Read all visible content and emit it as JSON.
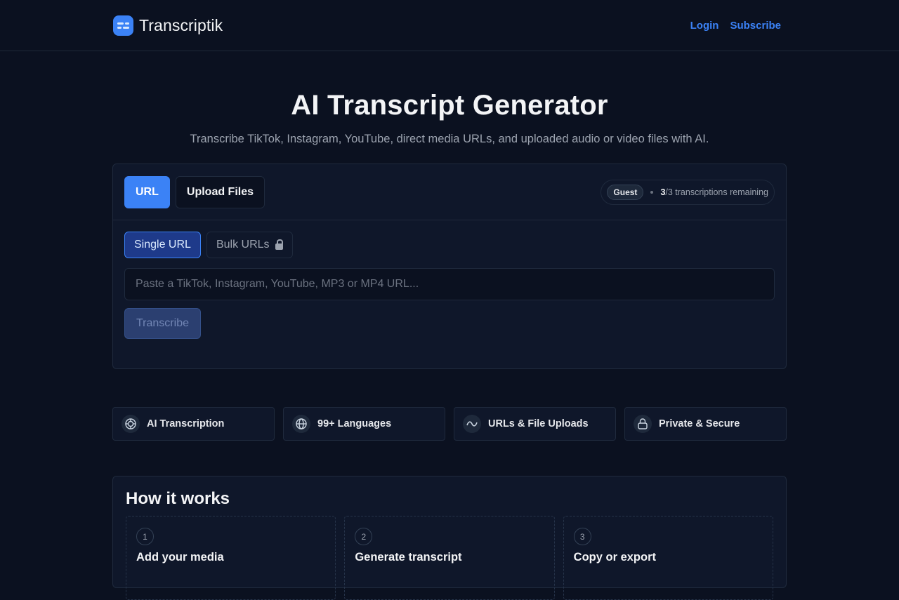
{
  "header": {
    "brand": "Transcriptik",
    "nav": {
      "login": "Login",
      "subscribe": "Subscribe"
    }
  },
  "hero": {
    "title": "AI Transcript Generator",
    "subtitle": "Transcribe TikTok, Instagram, YouTube, direct media URLs, and uploaded audio or video files with AI."
  },
  "card": {
    "mode_tabs": [
      {
        "label": "URL",
        "active": true
      },
      {
        "label": "Upload Files",
        "active": false
      }
    ],
    "quota": {
      "badge": "Guest",
      "used": "3",
      "total": "/3 transcriptions remaining"
    },
    "sub_tabs": [
      {
        "label": "Single URL",
        "active": true
      },
      {
        "label": "Bulk URLs",
        "locked": true
      }
    ],
    "input": {
      "value": "",
      "placeholder": "Paste a TikTok, Instagram, YouTube, MP3 or MP4 URL..."
    },
    "submit_label": "Transcribe"
  },
  "features": [
    {
      "label": "AI Transcription",
      "icon": "target-icon"
    },
    {
      "label": "99+ Languages",
      "icon": "globe-icon"
    },
    {
      "label": "URLs & File Uploads",
      "icon": "wave-icon"
    },
    {
      "label": "Private & Secure",
      "icon": "lock-icon"
    }
  ],
  "how": {
    "title": "How it works",
    "steps": [
      {
        "num": "1",
        "title": "Add your media"
      },
      {
        "num": "2",
        "title": "Generate transcript"
      },
      {
        "num": "3",
        "title": "Copy or export"
      }
    ]
  },
  "colors": {
    "accent": "#3b82f6",
    "background": "#0b1120",
    "surface": "#0f172a"
  }
}
